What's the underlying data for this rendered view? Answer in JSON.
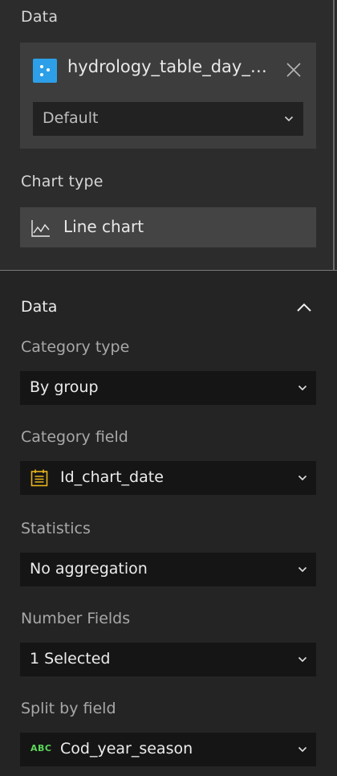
{
  "data_section": {
    "title": "Data",
    "datasource": {
      "icon": "table-icon",
      "name": "hydrology_table_day_…",
      "color": "#2d9fe8"
    },
    "view_select": {
      "value": "Default"
    }
  },
  "chart_type": {
    "title": "Chart type",
    "value": "Line chart",
    "icon": "line-chart-icon"
  },
  "data_config": {
    "title": "Data",
    "category_type": {
      "label": "Category type",
      "value": "By group"
    },
    "category_field": {
      "label": "Category field",
      "value": "Id_chart_date",
      "icon": "date-field-icon",
      "icon_color": "#e8b51b"
    },
    "statistics": {
      "label": "Statistics",
      "value": "No aggregation"
    },
    "number_fields": {
      "label": "Number Fields",
      "value": "1 Selected"
    },
    "split_by_field": {
      "label": "Split by field",
      "value": "Cod_year_season",
      "icon_text": "ABC",
      "icon_color": "#5bd85b"
    }
  }
}
